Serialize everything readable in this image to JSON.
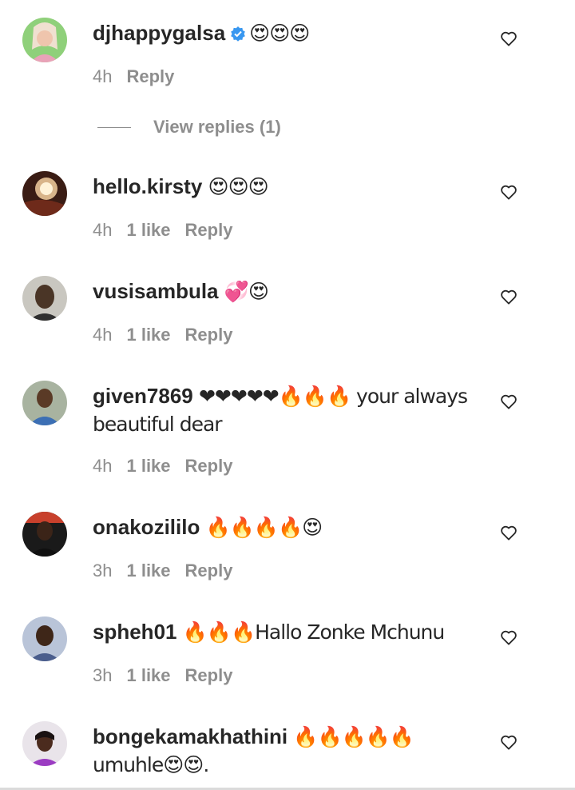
{
  "comments": [
    {
      "username": "djhappygalsa",
      "verified": true,
      "text": "😍😍😍",
      "time": "4h",
      "likes": "",
      "reply": "Reply",
      "avatar": "person-avatar-icon"
    },
    {
      "username": "hello.kirsty",
      "verified": false,
      "text": "😍😍😍",
      "time": "4h",
      "likes": "1 like",
      "reply": "Reply",
      "avatar": "person-avatar-icon"
    },
    {
      "username": "vusisambula",
      "verified": false,
      "text": "💞😍",
      "time": "4h",
      "likes": "1 like",
      "reply": "Reply",
      "avatar": "person-avatar-icon"
    },
    {
      "username": "given7869",
      "verified": false,
      "text": "❤❤❤❤❤🔥🔥🔥 your always beautiful dear",
      "time": "4h",
      "likes": "1 like",
      "reply": "Reply",
      "avatar": "person-avatar-icon"
    },
    {
      "username": "onakozililo",
      "verified": false,
      "text": "🔥🔥🔥🔥😍",
      "time": "3h",
      "likes": "1 like",
      "reply": "Reply",
      "avatar": "person-avatar-icon"
    },
    {
      "username": "spheh01",
      "verified": false,
      "text": "🔥🔥🔥Hallo Zonke Mchunu",
      "time": "3h",
      "likes": "1 like",
      "reply": "Reply",
      "avatar": "person-avatar-icon"
    },
    {
      "username": "bongekamakhathini",
      "verified": false,
      "text": "🔥🔥🔥🔥🔥 umuhle😍😍.",
      "time": "",
      "likes": "",
      "reply": "",
      "avatar": "person-avatar-icon"
    }
  ],
  "view_replies": "View replies (1)",
  "colors": {
    "text": "#262626",
    "muted": "#8e8e8e",
    "verified": "#3897f0"
  },
  "icons": {
    "like": "heart-outline-icon",
    "verified": "verified-badge-icon"
  }
}
